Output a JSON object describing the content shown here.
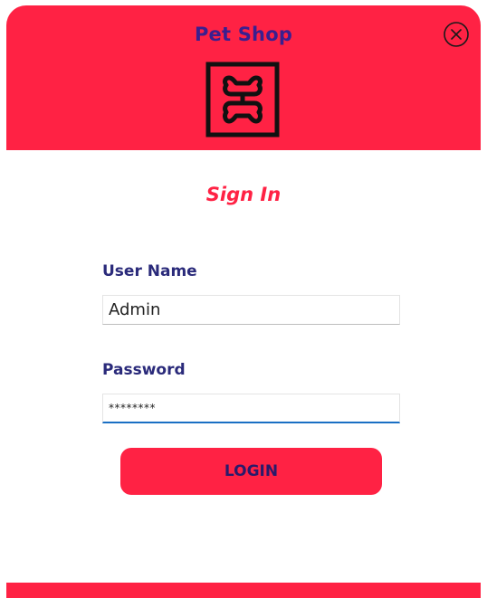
{
  "header": {
    "title": "Pet Shop",
    "close_icon": "close-circle-icon",
    "logo_icon": "paw-bone-logo-icon"
  },
  "form": {
    "heading": "Sign In",
    "username_label": "User Name",
    "username_value": "Admin",
    "password_label": "Password",
    "password_value": "********",
    "login_label": "LOGIN"
  },
  "colors": {
    "accent": "#ff2244",
    "title_text": "#3a1f8f",
    "label_text": "#2a2a7a",
    "focus_underline": "#1a6fc4"
  }
}
